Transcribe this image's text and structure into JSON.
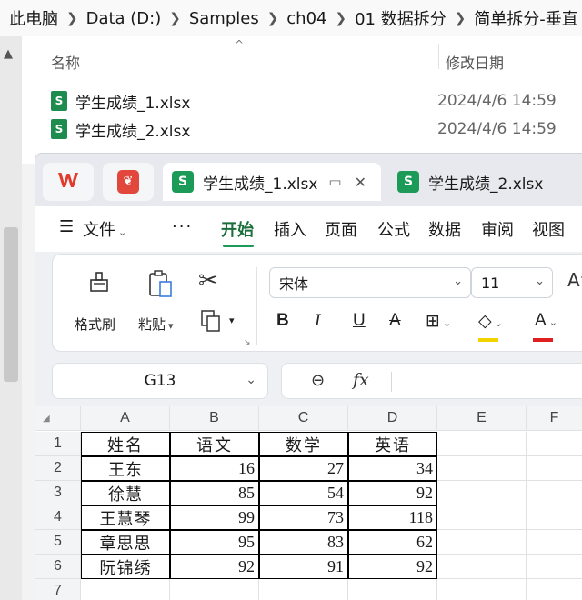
{
  "explorer": {
    "breadcrumb": [
      "此电脑",
      "Data (D:)",
      "Samples",
      "ch04",
      "01 数据拆分",
      "简单拆分-垂直"
    ],
    "columns": {
      "name": "名称",
      "modified": "修改日期"
    },
    "files": [
      {
        "name": "学生成绩_1.xlsx",
        "date": "2024/4/6 14:59",
        "icon": "S"
      },
      {
        "name": "学生成绩_2.xlsx",
        "date": "2024/4/6 14:59",
        "icon": "S"
      }
    ]
  },
  "wps": {
    "tabs": [
      {
        "label": "学生成绩_1.xlsx",
        "icon": "S",
        "active": true
      },
      {
        "label": "学生成绩_2.xlsx",
        "icon": "S",
        "active": false
      }
    ],
    "menu": {
      "file": "文件",
      "more": "···",
      "items": [
        "开始",
        "插入",
        "页面",
        "公式",
        "数据",
        "审阅",
        "视图"
      ],
      "active": "开始"
    },
    "ribbon": {
      "format_painter": "格式刷",
      "paste": "粘贴",
      "font_name": "宋体",
      "font_size": "11",
      "bold": "B",
      "italic": "I",
      "underline": "U",
      "strike": "A",
      "font_color_letter": "A",
      "highlight_color": "#f2d300",
      "font_color": "#e02020"
    },
    "name_box": "G13",
    "fx": "fx"
  },
  "sheet": {
    "columns": [
      "A",
      "B",
      "C",
      "D",
      "E",
      "F"
    ],
    "rows": [
      "1",
      "2",
      "3",
      "4",
      "5",
      "6",
      "7"
    ],
    "header": [
      "姓名",
      "语文",
      "数学",
      "英语"
    ],
    "data": [
      [
        "王东",
        "16",
        "27",
        "34"
      ],
      [
        "徐慧",
        "85",
        "54",
        "92"
      ],
      [
        "王慧琴",
        "99",
        "73",
        "118"
      ],
      [
        "章思思",
        "95",
        "83",
        "62"
      ],
      [
        "阮锦绣",
        "92",
        "91",
        "92"
      ]
    ]
  }
}
